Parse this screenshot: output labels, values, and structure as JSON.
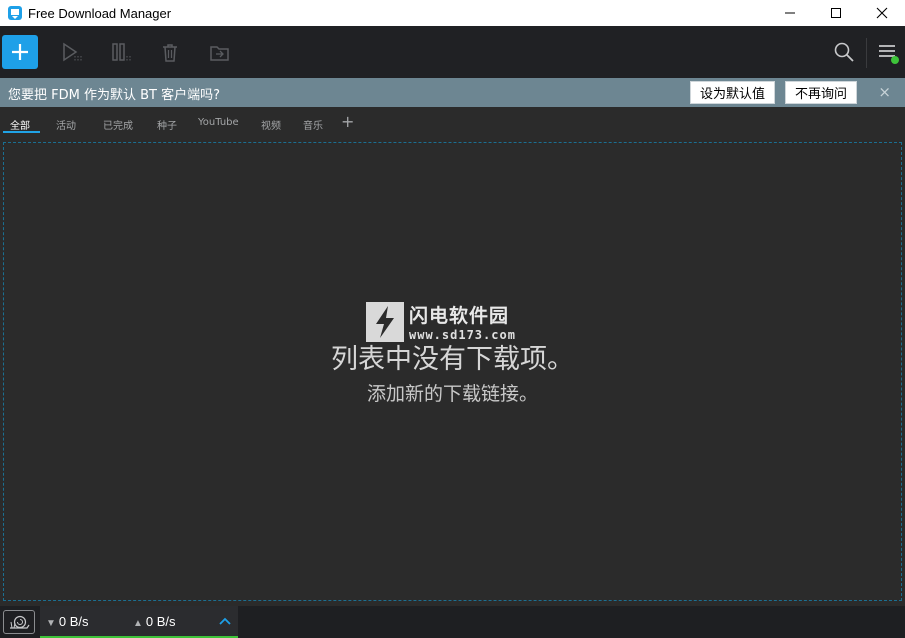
{
  "window": {
    "title": "Free Download Manager"
  },
  "toolbar": {
    "icons": [
      "plus-icon",
      "play-icon",
      "pause-icon",
      "trash-icon",
      "move-folder-icon",
      "search-icon",
      "hamburger-menu-icon"
    ]
  },
  "notice": {
    "text": "您要把 FDM 作为默认 BT 客户端吗?",
    "set_default_label": "设为默认值",
    "dont_ask_label": "不再询问",
    "close_label": "×"
  },
  "tabs": [
    {
      "label": "全部"
    },
    {
      "label": "活动"
    },
    {
      "label": "已完成"
    },
    {
      "label": "种子"
    },
    {
      "label": "YouTube"
    },
    {
      "label": "视频"
    },
    {
      "label": "音乐"
    }
  ],
  "tab_add_label": "+",
  "empty_state": {
    "title": "列表中没有下载项。",
    "subtitle": "添加新的下载链接。"
  },
  "watermark": {
    "name": "闪电软件园",
    "url": "www.sd173.com"
  },
  "status": {
    "download_speed": "0 B/s",
    "upload_speed": "0 B/s",
    "down_arrow": "▼",
    "up_arrow": "▲"
  },
  "colors": {
    "accent": "#1ea0e8",
    "notice_bg": "#6d8692",
    "online_dot": "#3ec43a"
  }
}
